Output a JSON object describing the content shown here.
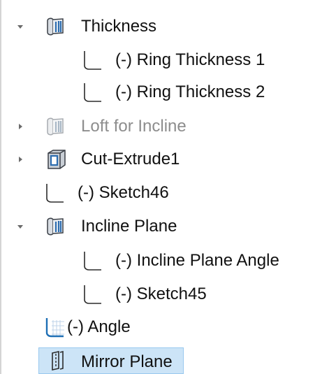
{
  "tree": {
    "items": [
      {
        "label": "Thickness",
        "icon": "loft-feature-icon",
        "toggle": "expanded"
      },
      {
        "label": "(-) Ring Thickness 1",
        "icon": "sketch-icon"
      },
      {
        "label": "(-) Ring Thickness 2",
        "icon": "sketch-icon"
      },
      {
        "label": "Loft for Incline",
        "icon": "loft-feature-icon",
        "toggle": "collapsed",
        "state": "suppressed"
      },
      {
        "label": "Cut-Extrude1",
        "icon": "cut-extrude-icon",
        "toggle": "collapsed"
      },
      {
        "label": "(-) Sketch46",
        "icon": "sketch-icon"
      },
      {
        "label": "Incline Plane",
        "icon": "loft-feature-icon",
        "toggle": "expanded"
      },
      {
        "label": "(-) Incline Plane Angle",
        "icon": "sketch-icon"
      },
      {
        "label": "(-) Sketch45",
        "icon": "sketch-icon"
      },
      {
        "label": "(-) Angle",
        "icon": "3d-sketch-icon"
      },
      {
        "label": "Mirror Plane",
        "icon": "mirror-plane-icon",
        "state": "selected"
      }
    ]
  },
  "colors": {
    "selection_bg": "#cce4f7",
    "selection_border": "#99c9ef",
    "suppressed_text": "#8d8d8d",
    "sketch_blue": "#1e6fb5"
  }
}
